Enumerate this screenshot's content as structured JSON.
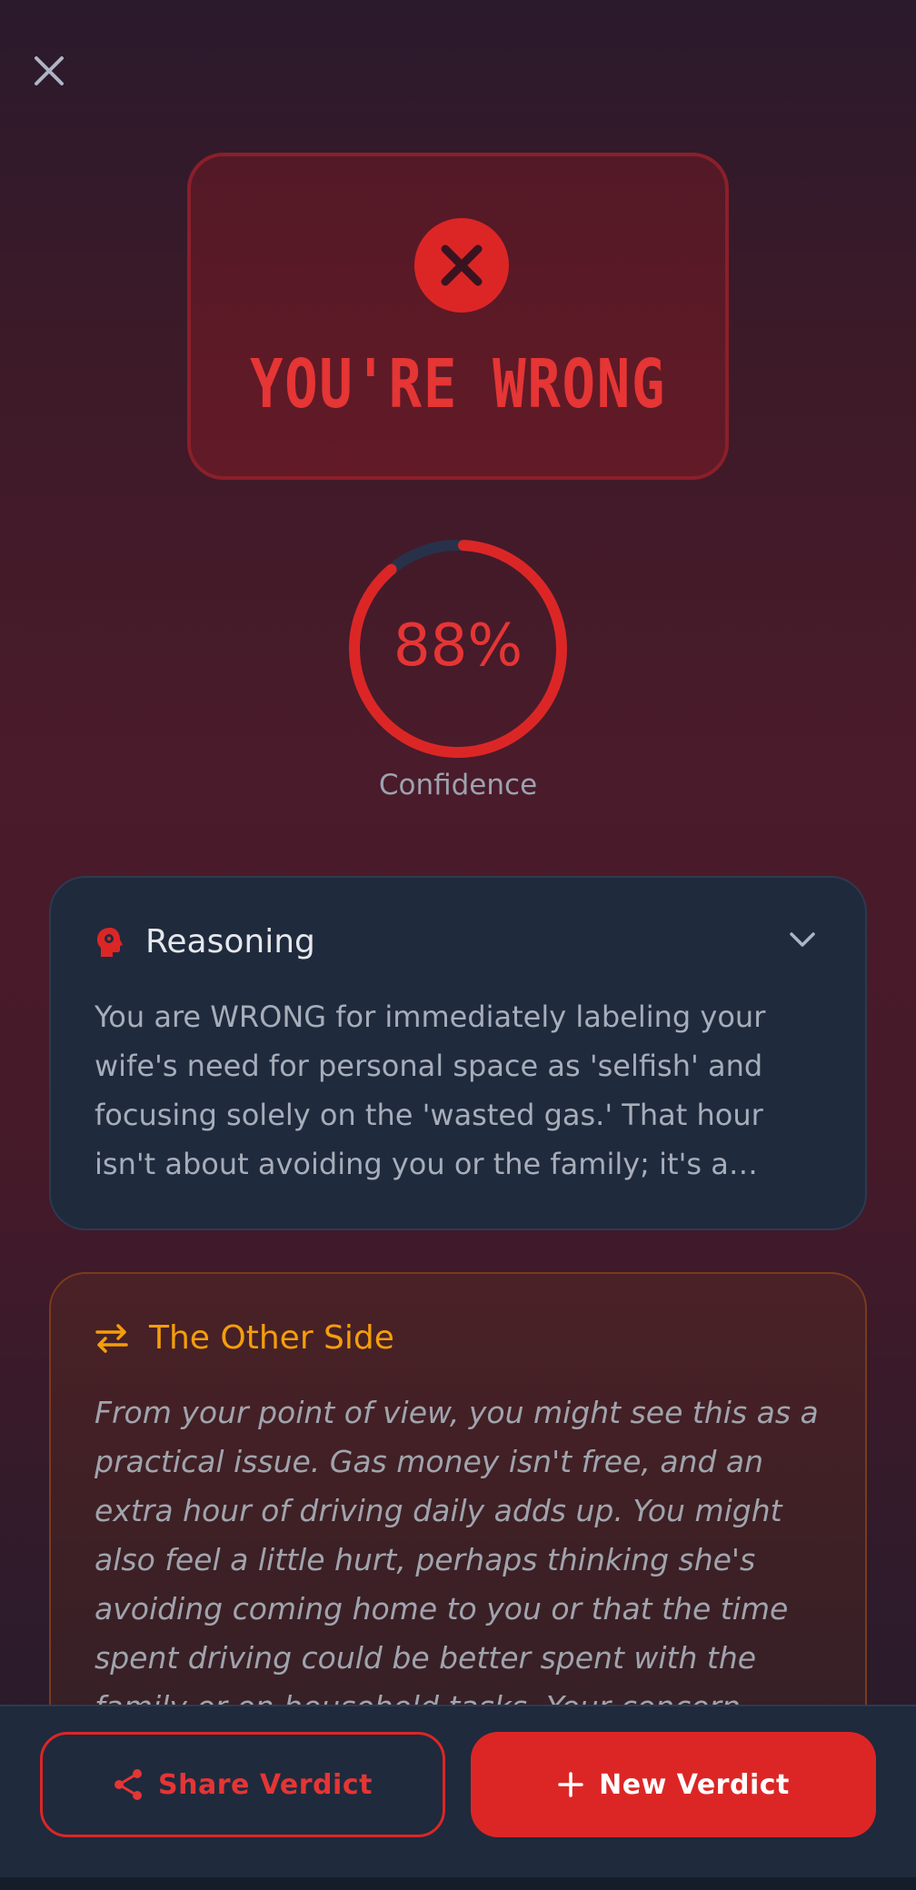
{
  "verdict": {
    "title": "YOU'RE WRONG",
    "accent_color": "#dc2626"
  },
  "confidence": {
    "value": 88,
    "display": "88%",
    "label": "Confidence"
  },
  "reasoning": {
    "title": "Reasoning",
    "text": "You are WRONG for immediately labeling your wife's need for personal space as 'selfish' and focusing solely on the 'wasted gas.' That hour isn't about avoiding you or the family; it's a crucial..."
  },
  "other_side": {
    "title": "The Other Side",
    "title_color": "#f59e0b",
    "text": "From your point of view, you might see this as a practical issue. Gas money isn't free, and an extra hour of driving daily adds up. You might also feel a little hurt, perhaps thinking she's avoiding coming home to you or that the time spent driving could be better spent with the family or on household tasks. Your concern"
  },
  "actions": {
    "share_label": "Share Verdict",
    "new_label": "New Verdict"
  },
  "icons": {
    "close": "close-icon",
    "verdict": "x-circle-icon",
    "reasoning": "brain-head-icon",
    "chevron": "chevron-down-icon",
    "other_side": "swap-arrows-icon",
    "share": "share-icon",
    "plus": "plus-icon"
  }
}
